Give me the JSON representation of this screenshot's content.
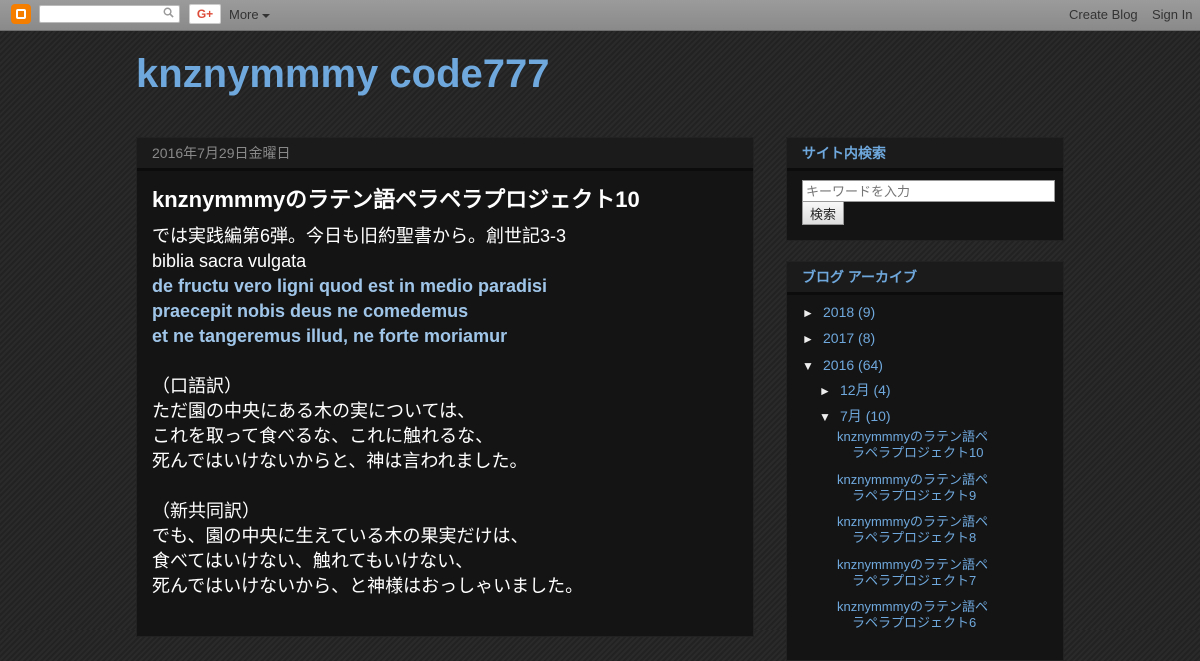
{
  "navbar": {
    "more_label": "More",
    "create_blog": "Create Blog",
    "sign_in": "Sign In",
    "gplus_label": "G+"
  },
  "blog": {
    "title": "knznymmmy code777"
  },
  "post": {
    "date": "2016年7月29日金曜日",
    "title": "knznymmmyのラテン語ペラペラプロジェクト10",
    "lines": [
      "では実践編第6弾。今日も旧約聖書から。創世記3-3",
      "biblia sacra vulgata",
      "de fructu vero ligni quod est in medio paradisi",
      "praecepit nobis deus ne comedemus",
      "et ne tangeremus illud, ne forte moriamur",
      "",
      "（口語訳）",
      "ただ園の中央にある木の実については、",
      "これを取って食べるな、これに触れるな、",
      "死んではいけないからと、神は言われました。",
      "",
      "（新共同訳）",
      "でも、園の中央に生えている木の果実だけは、",
      "食べてはいけない、触れてもいけない、",
      "死んではいけないから、と神様はおっしゃいました。"
    ]
  },
  "sidebar": {
    "search": {
      "title": "サイト内検索",
      "placeholder": "キーワードを入力",
      "button": "検索"
    },
    "archive": {
      "title": "ブログ アーカイブ",
      "years": [
        {
          "toggle": "►",
          "label": "2018",
          "count": "(9)"
        },
        {
          "toggle": "►",
          "label": "2017",
          "count": "(8)"
        },
        {
          "toggle": "▼",
          "label": "2016",
          "count": "(64)"
        }
      ],
      "months": [
        {
          "toggle": "►",
          "label": "12月",
          "count": "(4)"
        },
        {
          "toggle": "▼",
          "label": "7月",
          "count": "(10)"
        }
      ],
      "posts": [
        {
          "line1": "knznymmmyのラテン語ペ",
          "line2": "ラペラプロジェクト10"
        },
        {
          "line1": "knznymmmyのラテン語ペ",
          "line2": "ラペラプロジェクト9"
        },
        {
          "line1": "knznymmmyのラテン語ペ",
          "line2": "ラペラプロジェクト8"
        },
        {
          "line1": "knznymmmyのラテン語ペ",
          "line2": "ラペラプロジェクト7"
        },
        {
          "line1": "knznymmmyのラテン語ペ",
          "line2": "ラペラプロジェクト6"
        }
      ]
    }
  }
}
